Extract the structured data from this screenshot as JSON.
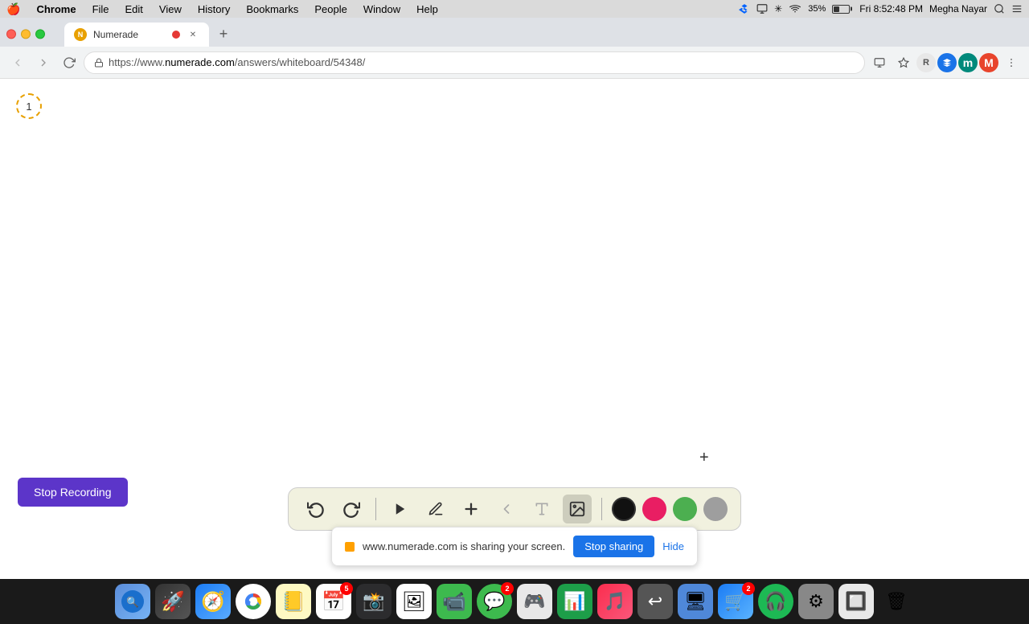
{
  "menubar": {
    "apple": "🍎",
    "items": [
      "Chrome",
      "File",
      "Edit",
      "View",
      "History",
      "Bookmarks",
      "People",
      "Window",
      "Help"
    ],
    "bold_item": "Chrome",
    "time": "Fri 8:52:48 PM",
    "user": "Megha Nayar",
    "battery_percent": "35%"
  },
  "browser": {
    "tab": {
      "title": "Numerade",
      "favicon": "N"
    },
    "url": "https://www.numerade.com/answers/whiteboard/54348/",
    "url_domain": "numerade.com",
    "url_path": "/answers/whiteboard/54348/"
  },
  "whiteboard": {
    "page_number": "1",
    "plus_symbol": "+"
  },
  "toolbar": {
    "undo_label": "↩",
    "redo_label": "↪",
    "pen_label": "✏",
    "add_label": "+",
    "eraser_label": "◁",
    "text_label": "A",
    "image_label": "🖼",
    "colors": [
      "#111111",
      "#e91e63",
      "#4caf50",
      "#9e9e9e"
    ]
  },
  "stop_recording": {
    "label": "Stop Recording"
  },
  "screen_share": {
    "text": "www.numerade.com is sharing your screen.",
    "stop_button": "Stop sharing",
    "hide_button": "Hide"
  },
  "dock": {
    "items": [
      {
        "icon": "🔍",
        "label": "finder",
        "color": "#5b8dd9"
      },
      {
        "icon": "🚀",
        "label": "launchpad",
        "color": "#777"
      },
      {
        "icon": "🧭",
        "label": "safari",
        "color": "#1b7cf4"
      },
      {
        "icon": "🌐",
        "label": "chrome",
        "color": "#4285f4"
      },
      {
        "icon": "📒",
        "label": "notes",
        "color": "#f5c518"
      },
      {
        "icon": "📅",
        "label": "calendar",
        "color": "#e53935",
        "badge": "5"
      },
      {
        "icon": "📸",
        "label": "screenshot",
        "color": "#555"
      },
      {
        "icon": "🖼",
        "label": "photos",
        "color": "#f06"
      },
      {
        "icon": "📹",
        "label": "facetime",
        "color": "#3dba4e"
      },
      {
        "icon": "💬",
        "label": "messages",
        "color": "#3dba4e",
        "badge": "2"
      },
      {
        "icon": "🎮",
        "label": "app1",
        "color": "#777"
      },
      {
        "icon": "📊",
        "label": "numbers",
        "color": "#1d9e49"
      },
      {
        "icon": "🎵",
        "label": "music",
        "color": "#e8457a"
      },
      {
        "icon": "↩",
        "label": "undo",
        "color": "#555"
      },
      {
        "icon": "🖥",
        "label": "keynote",
        "color": "#4f88d9"
      },
      {
        "icon": "🛒",
        "label": "appstore",
        "color": "#1b7cf4",
        "badge": "2"
      },
      {
        "icon": "🎧",
        "label": "spotify",
        "color": "#1db954"
      },
      {
        "icon": "⚙",
        "label": "systemprefs",
        "color": "#888"
      },
      {
        "icon": "🔲",
        "label": "preview",
        "color": "#666"
      },
      {
        "icon": "🗑",
        "label": "trash",
        "color": "#888"
      }
    ]
  }
}
